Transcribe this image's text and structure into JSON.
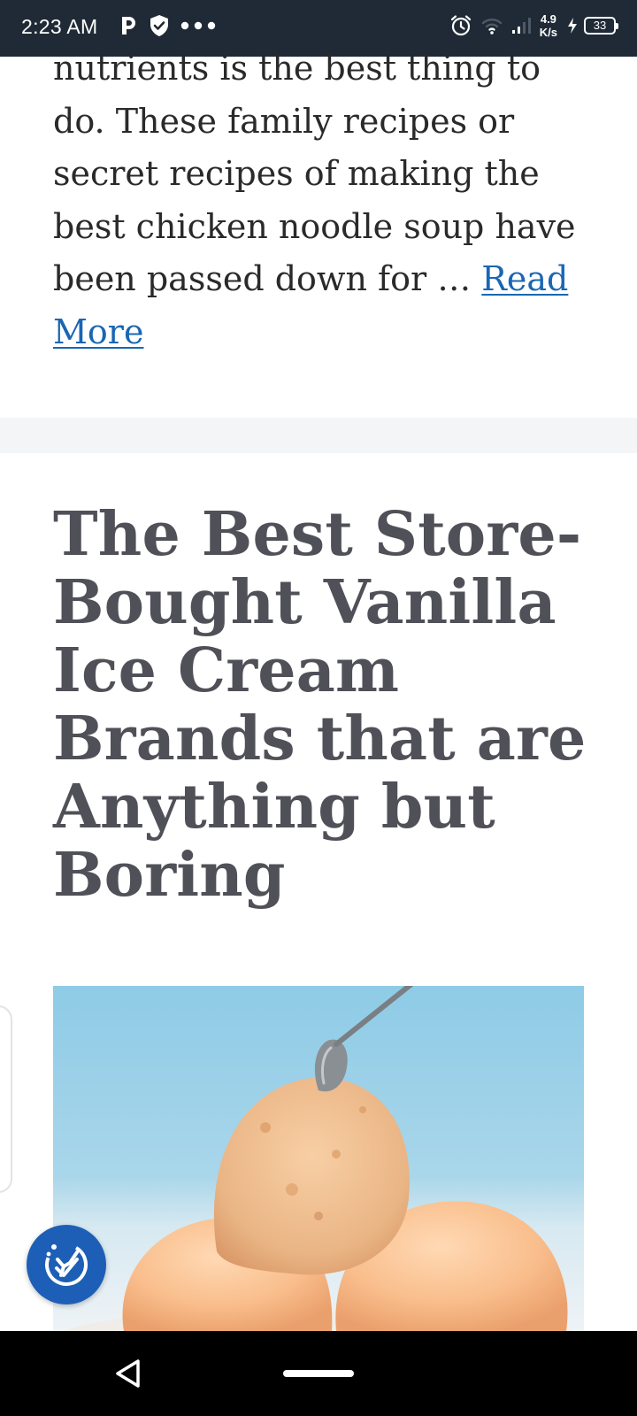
{
  "status_bar": {
    "time": "2:23 AM",
    "net_speed_value": "4.9",
    "net_speed_unit": "K/s",
    "battery_level": "33",
    "left_icons": [
      "parking-app-icon",
      "shield-check-icon",
      "more-dots-icon"
    ],
    "right_icons": [
      "alarm-icon",
      "wifi-icon",
      "signal-icon",
      "charging-icon"
    ]
  },
  "article": {
    "excerpt_text": "nutrients is the best thing to do. These family recipes or secret recipes of making the best chicken noodle soup have been passed down for … ",
    "read_more_label": "Read More"
  },
  "next_post": {
    "title": "The Best Store-Bought Vanilla Ice Cream Brands that are Anything but Boring",
    "image_subject": "ice-cream-scoops-with-spoon"
  },
  "accessibility": {
    "icon": "accessibility-check-icon"
  },
  "colors": {
    "status_bar_bg": "#1f2a36",
    "link": "#1a66b3",
    "title": "#505058",
    "accessibility_button": "#1d5fb6",
    "image_sky": "#8ecbe6"
  }
}
